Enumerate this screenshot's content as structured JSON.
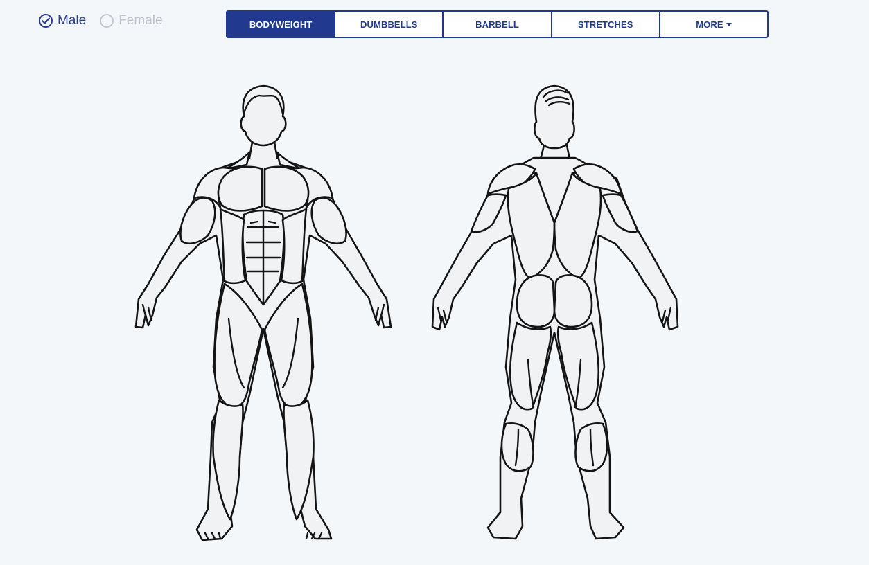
{
  "gender": {
    "male_label": "Male",
    "female_label": "Female",
    "selected": "male"
  },
  "tabs": [
    {
      "label": "BODYWEIGHT",
      "active": true
    },
    {
      "label": "DUMBBELLS",
      "active": false
    },
    {
      "label": "BARBELL",
      "active": false
    },
    {
      "label": "STRETCHES",
      "active": false
    },
    {
      "label": "MORE",
      "active": false
    }
  ],
  "colors": {
    "accent": "#213a8f",
    "background": "#f4f7fa",
    "muscle_fill": "#f1f2f4",
    "outline": "#141414"
  },
  "icons": {
    "male_radio": "check-circle-icon",
    "female_radio": "empty-circle-icon",
    "more_dropdown": "caret-down-icon"
  }
}
